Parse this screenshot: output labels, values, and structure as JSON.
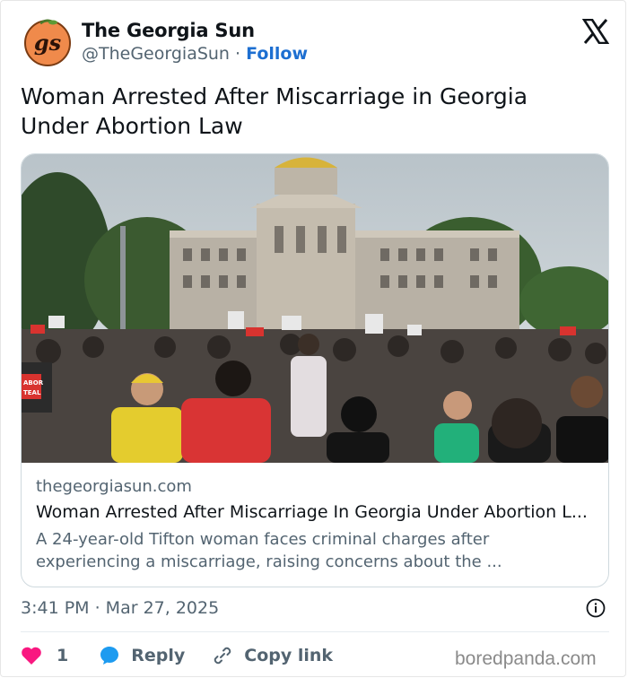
{
  "author": {
    "avatar_text": "gs",
    "name": "The Georgia Sun",
    "handle": "@TheGeorgiaSun",
    "separator": " · ",
    "follow_label": "Follow"
  },
  "header": {
    "logo_icon": "x-logo-icon"
  },
  "tweet": {
    "text": "Woman Arrested After Miscarriage in Georgia Under Abortion Law"
  },
  "link_card": {
    "image_alt": "Protest crowd in front of Georgia State Capitol",
    "sign_texts": [
      "ABOR",
      "TEAL"
    ],
    "domain": "thegeorgiasun.com",
    "title": "Woman Arrested After Miscarriage In Georgia Under Abortion L...",
    "description": "A 24-year-old Tifton woman faces criminal charges after experiencing a miscarriage, raising concerns about the ..."
  },
  "meta": {
    "timestamp": "3:41 PM · Mar 27, 2025",
    "info_icon": "info-icon"
  },
  "actions": {
    "like_count": "1",
    "reply_label": "Reply",
    "copy_link_label": "Copy link"
  },
  "watermark": "boredpanda.com",
  "colors": {
    "like": "#f91880",
    "reply": "#1d9bf0",
    "follow": "#1d6fd1",
    "muted": "#536471"
  }
}
